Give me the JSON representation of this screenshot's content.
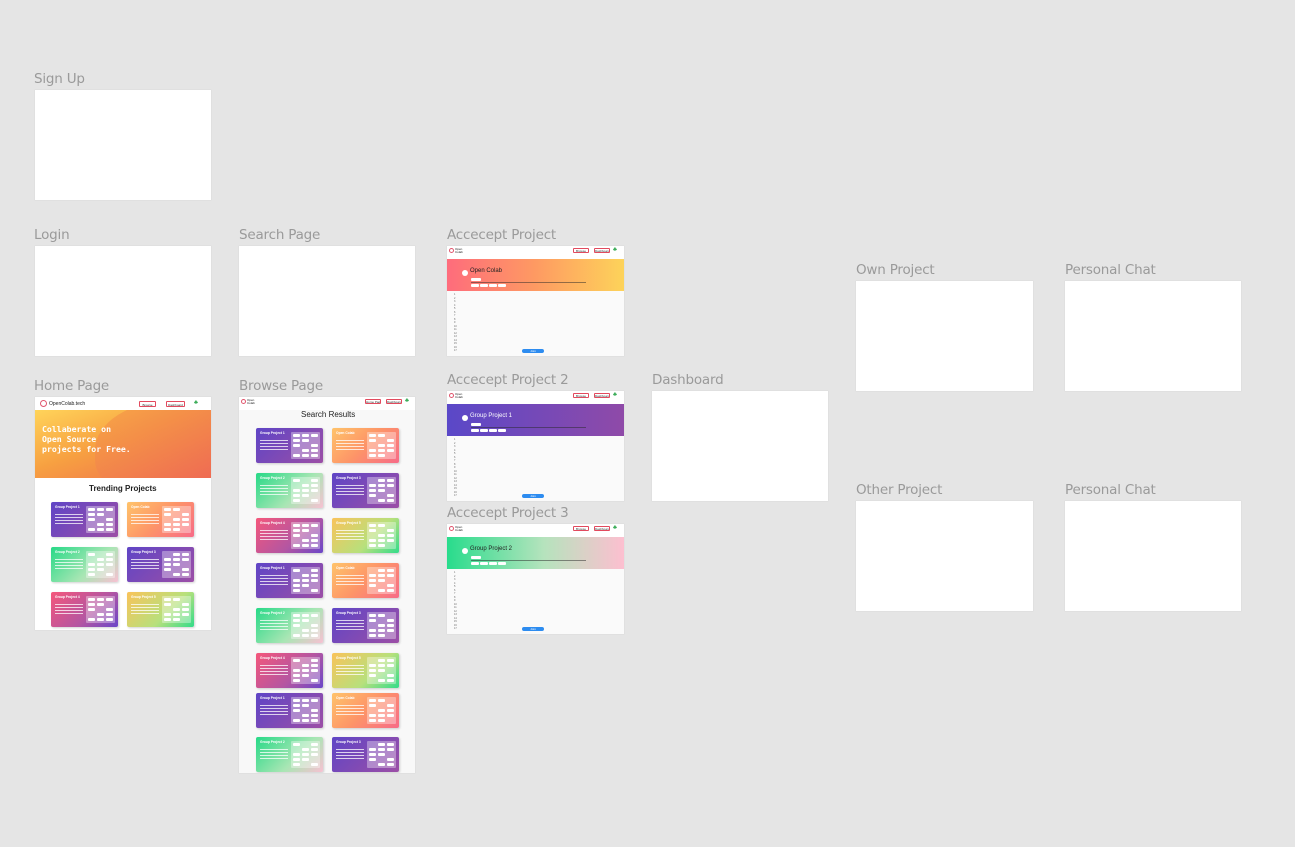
{
  "canvas": {
    "background": "#e5e5e5"
  },
  "frames": {
    "sign_up": {
      "label": "Sign Up"
    },
    "login": {
      "label": "Login"
    },
    "search_page": {
      "label": "Search Page"
    },
    "home_page": {
      "label": "Home Page",
      "logo_text": "OpenColab.tech",
      "nav_browse": "Browse",
      "nav_dashboard": "Dashboard",
      "hero_text": "Collaberate on Open Source projects for Free.",
      "section_title": "Trending Projects",
      "cards": [
        {
          "title": "Group Project 1",
          "theme": "purple"
        },
        {
          "title": "Open Colab",
          "theme": "coral"
        },
        {
          "title": "Group Project 2",
          "theme": "green"
        },
        {
          "title": "Group Project 3",
          "theme": "purple"
        },
        {
          "title": "Group Project 4",
          "theme": "pink"
        },
        {
          "title": "Group Project 5",
          "theme": "gold"
        }
      ]
    },
    "browse_page": {
      "label": "Browse Page",
      "logo_text": "Open Colab",
      "nav_home": "Home Page",
      "nav_dashboard": "Dashboard",
      "section_title": "Search Results",
      "cards": [
        {
          "title": "Group Project 1",
          "theme": "purple"
        },
        {
          "title": "Open Colab",
          "theme": "coral"
        },
        {
          "title": "Group Project 2",
          "theme": "green"
        },
        {
          "title": "Group Project 3",
          "theme": "purple"
        },
        {
          "title": "Group Project 4",
          "theme": "pink"
        },
        {
          "title": "Group Project 5",
          "theme": "gold"
        },
        {
          "title": "Group Project 1",
          "theme": "purple"
        },
        {
          "title": "Open Colab",
          "theme": "coral"
        },
        {
          "title": "Group Project 2",
          "theme": "green"
        },
        {
          "title": "Group Project 3",
          "theme": "purple"
        },
        {
          "title": "Group Project 4",
          "theme": "pink"
        },
        {
          "title": "Group Project 5",
          "theme": "gold"
        },
        {
          "title": "Group Project 1",
          "theme": "purple"
        },
        {
          "title": "Open Colab",
          "theme": "coral"
        },
        {
          "title": "Group Project 2",
          "theme": "green"
        },
        {
          "title": "Group Project 3",
          "theme": "purple"
        }
      ]
    },
    "accept_project": {
      "label": "Accecept Project",
      "logo_text": "Open Colab",
      "nav_browse": "Browse",
      "nav_dashboard": "Dashboard",
      "project_title": "Open Colab",
      "theme": "orange",
      "join_label": "Join"
    },
    "accept_project_2": {
      "label": "Accecept Project 2",
      "logo_text": "Open Colab",
      "nav_browse": "Browse",
      "nav_dashboard": "Dashboard",
      "project_title": "Group Project 1",
      "theme": "purple",
      "join_label": "Join"
    },
    "accept_project_3": {
      "label": "Accecept Project 3",
      "logo_text": "Open Colab",
      "nav_browse": "Browse",
      "nav_dashboard": "Dashboard",
      "project_title": "Group Project 2",
      "theme": "green",
      "join_label": "Join"
    },
    "dashboard": {
      "label": "Dashboard"
    },
    "own_project": {
      "label": "Own Project"
    },
    "personal_chat_1": {
      "label": "Personal Chat"
    },
    "other_project": {
      "label": "Other Project"
    },
    "personal_chat_2": {
      "label": "Personal Chat"
    }
  }
}
